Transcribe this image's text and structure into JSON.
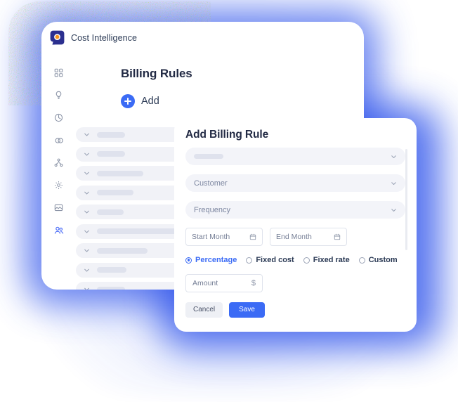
{
  "app": {
    "brand_name": "Cost Intelligence",
    "logo_icon": "cost-intelligence-logo",
    "accent_color": "#3b6bf5",
    "logo_outer_color": "#2b2f8f",
    "logo_inner_color": "#f7941e",
    "glow_color": "#2f54eb"
  },
  "sidebar": {
    "items": [
      {
        "icon": "dashboard-grid-icon",
        "active": false
      },
      {
        "icon": "bulb-idea-icon",
        "active": false
      },
      {
        "icon": "clock-pie-icon",
        "active": false
      },
      {
        "icon": "link-chain-icon",
        "active": false
      },
      {
        "icon": "hierarchy-sitemap-icon",
        "active": false
      },
      {
        "icon": "gear-settings-icon",
        "active": false
      },
      {
        "icon": "image-report-icon",
        "active": false
      },
      {
        "icon": "users-people-icon",
        "active": true
      }
    ]
  },
  "page": {
    "title": "Billing Rules",
    "add_label": "Add",
    "add_icon": "plus-icon"
  },
  "rules_list": {
    "row_chevron_icon": "chevron-down-icon",
    "rows": [
      {
        "skeleton_width": 40
      },
      {
        "skeleton_width": 40
      },
      {
        "skeleton_width": 66
      },
      {
        "skeleton_width": 52
      },
      {
        "skeleton_width": 38
      },
      {
        "skeleton_width": 120
      },
      {
        "skeleton_width": 72
      },
      {
        "skeleton_width": 42
      },
      {
        "skeleton_width": 40
      }
    ]
  },
  "modal": {
    "title": "Add Billing Rule",
    "caret_icon": "chevron-down-icon",
    "calendar_icon": "calendar-icon",
    "fields": {
      "rule_select": {
        "value": "",
        "skeleton": true
      },
      "customer_select": {
        "placeholder": "Customer",
        "value": ""
      },
      "frequency_select": {
        "placeholder": "Frequency",
        "value": ""
      },
      "start_month": {
        "placeholder": "Start Month",
        "value": ""
      },
      "end_month": {
        "placeholder": "End Month",
        "value": ""
      },
      "amount": {
        "placeholder": "Amount",
        "value": "",
        "unit": "$"
      }
    },
    "rate_type": {
      "selected": "Percentage",
      "options": [
        "Percentage",
        "Fixed cost",
        "Fixed rate",
        "Custom"
      ]
    },
    "buttons": {
      "cancel_label": "Cancel",
      "save_label": "Save"
    }
  }
}
